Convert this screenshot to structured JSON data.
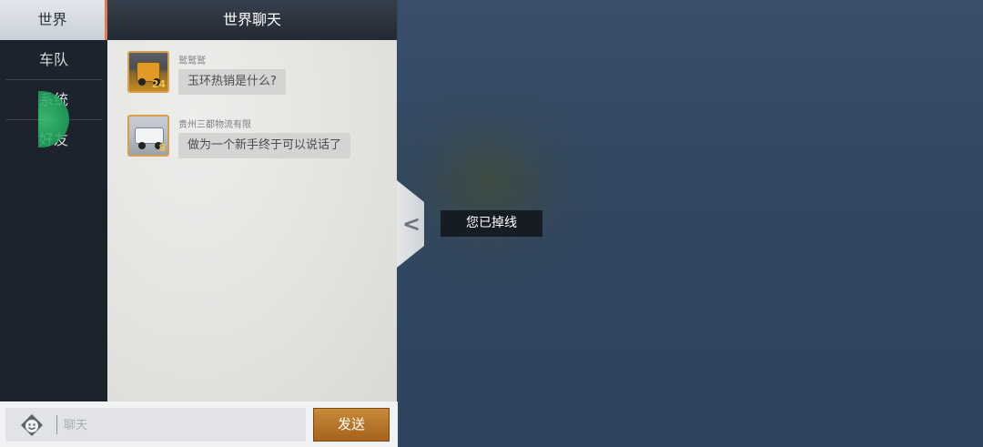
{
  "tabs": [
    {
      "label": "世界"
    },
    {
      "label": "车队"
    },
    {
      "label": "系统"
    },
    {
      "label": "好友"
    }
  ],
  "chat": {
    "title": "世界聊天",
    "messages": [
      {
        "username": "鹫鹫鹫",
        "text": "玉环热销是什么?",
        "level": "24"
      },
      {
        "username": "贵州三都物流有限",
        "text": "做为一个新手终于可以说话了",
        "level": "8"
      }
    ]
  },
  "toast": {
    "text": "您已掉线"
  },
  "input": {
    "placeholder": "聊天",
    "send_label": "发送"
  },
  "colors": {
    "accent": "#e07a4c",
    "send_button": "#b5732a",
    "background": "#33455e"
  },
  "icons": {
    "emoji": "smiley-icon",
    "collapse": "chevron-left-icon"
  }
}
